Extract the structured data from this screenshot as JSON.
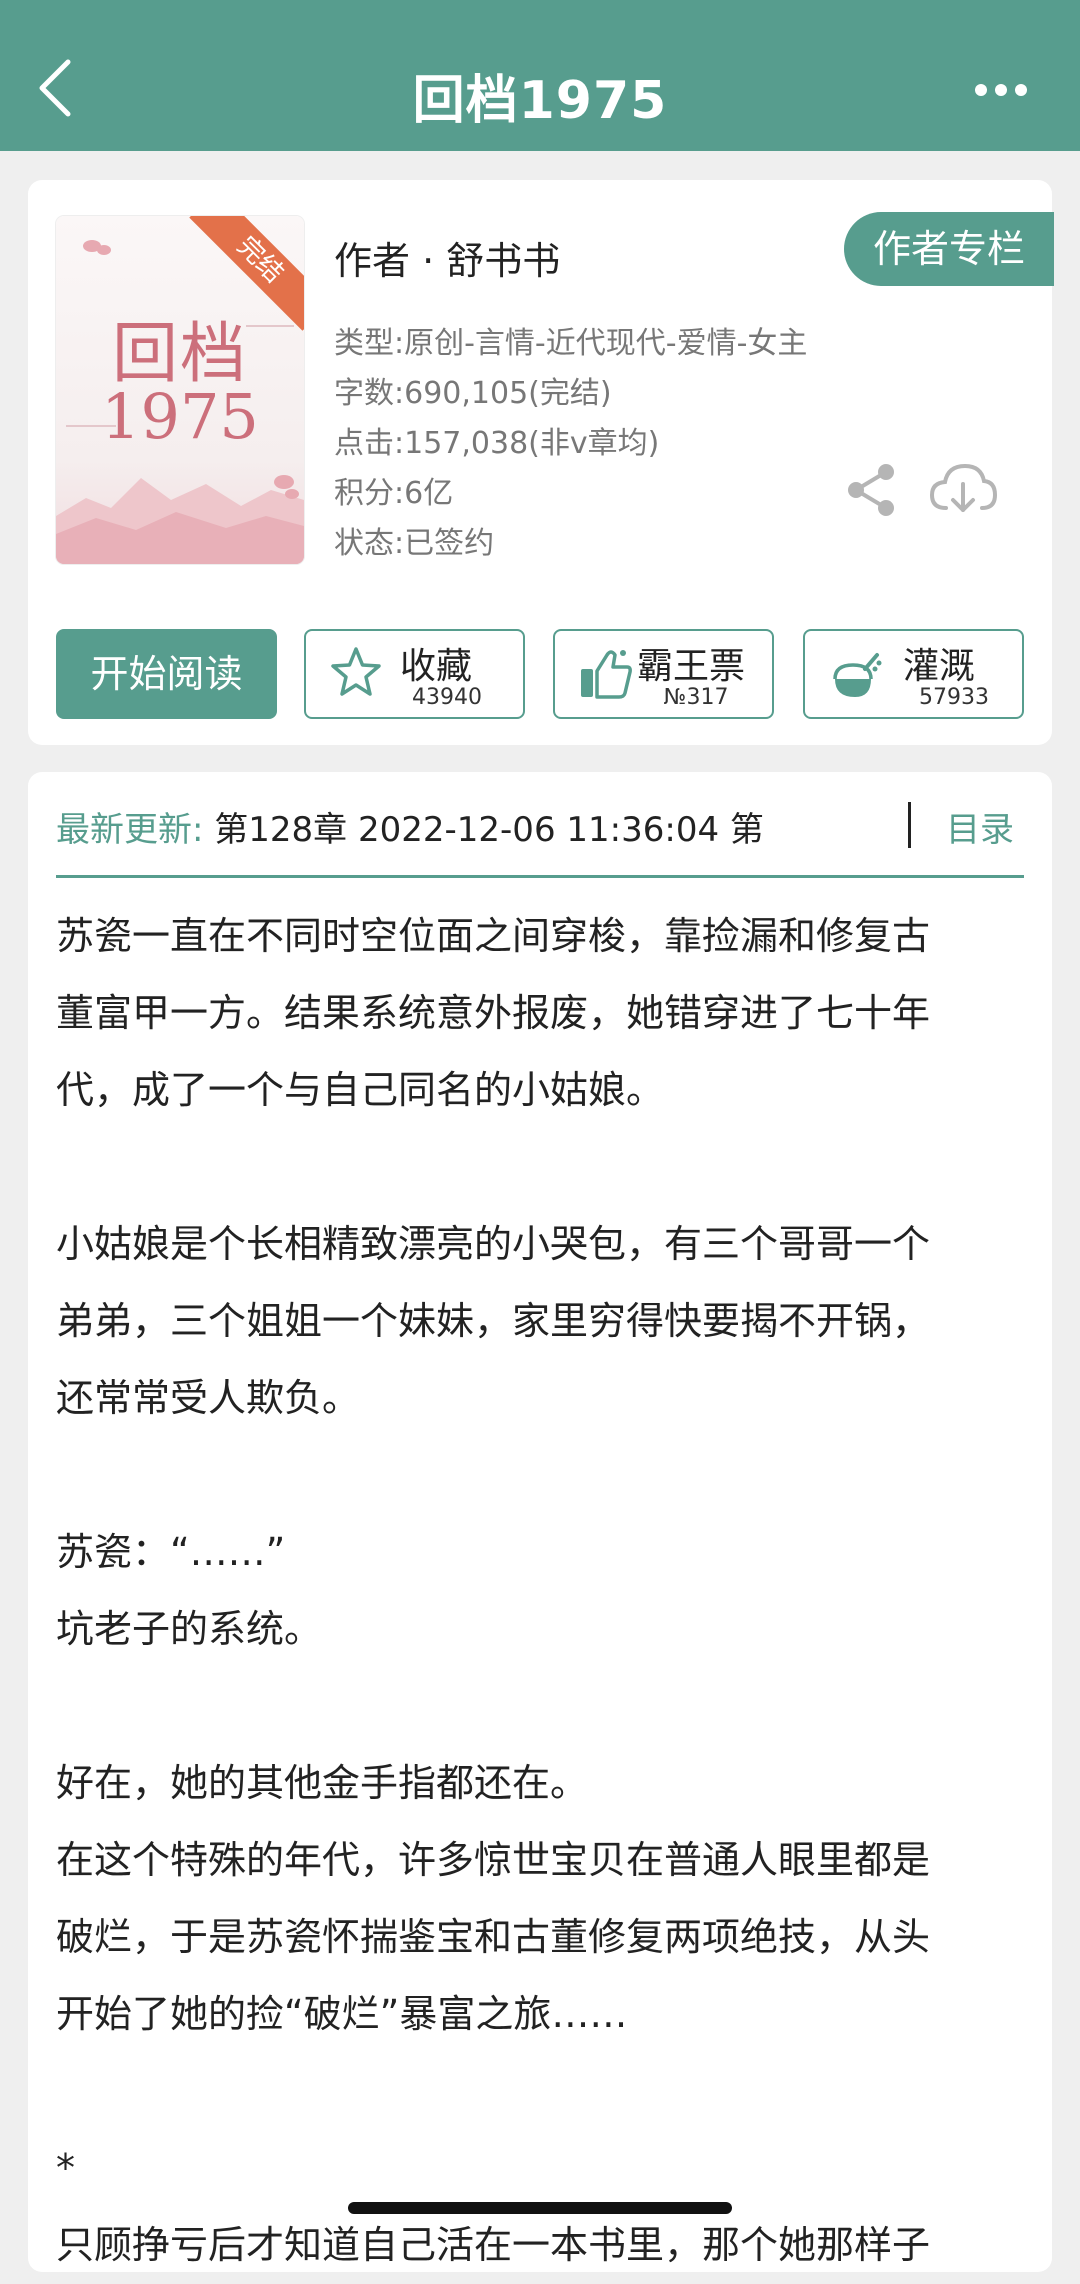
{
  "header": {
    "title": "回档1975"
  },
  "book": {
    "cover_title_line1": "回档",
    "cover_title_line2": "1975",
    "status_badge": "完结",
    "author": "作者 · 舒书书",
    "author_column_button": "作者专栏",
    "type": "类型:原创-言情-近代现代-爱情-女主",
    "words": "字数:690,105(完结)",
    "clicks": "点击:157,038(非v章均)",
    "points": "积分:6亿",
    "state": "状态:已签约"
  },
  "actions": {
    "read": "开始阅读",
    "favorite": {
      "label": "收藏",
      "count": "43940"
    },
    "overlord": {
      "label": "霸王票",
      "count": "№317"
    },
    "nutrient": {
      "label": "灌溉",
      "count": "57933"
    }
  },
  "update": {
    "label": "最新更新:",
    "info": " 第128章 2022-12-06 11:36:04   第",
    "toc": "目录"
  },
  "description": [
    "苏瓷一直在不同时空位面之间穿梭，靠捡漏和修复古",
    "董富甲一方。结果系统意外报废，她错穿进了七十年",
    "代，成了一个与自己同名的小姑娘。",
    "",
    "小姑娘是个长相精致漂亮的小哭包，有三个哥哥一个",
    "弟弟，三个姐姐一个妹妹，家里穷得快要揭不开锅，",
    "还常常受人欺负。",
    "",
    "苏瓷：“……”",
    "坑老子的系统。",
    "",
    "好在，她的其他金手指都还在。",
    "在这个特殊的年代，许多惊世宝贝在普通人眼里都是",
    "破烂，于是苏瓷怀揣鉴宝和古董修复两项绝技，从头",
    "开始了她的捡“破烂”暴富之旅……",
    "",
    "*",
    "只顾挣亏后才知道自己活在一本书里，那个她那样子"
  ],
  "colors": {
    "accent": "#579d8e",
    "badge": "#e3714a"
  },
  "icons": [
    "back-icon",
    "more-icon",
    "share-icon",
    "download-icon",
    "star-icon",
    "thumbs-up-icon",
    "watering-can-icon"
  ]
}
